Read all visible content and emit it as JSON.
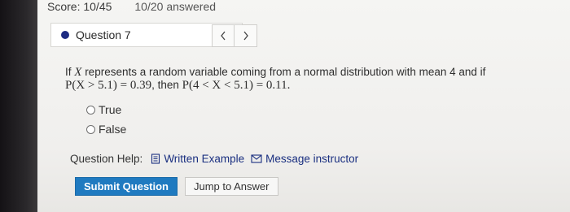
{
  "header": {
    "score": "Score: 10/45",
    "answered": "10/20 answered"
  },
  "question_nav": {
    "label": "Question 7",
    "prev_glyph": "<",
    "next_glyph": ">"
  },
  "question": {
    "line1_prefix": "If ",
    "line1_var": "X",
    "line1_rest": " represents a random variable coming from a normal distribution with mean 4 and if",
    "line2_expr1": "P(X > 5.1) = 0.39",
    "line2_then": ", then ",
    "line2_expr2": "P(4 < X < 5.1) = 0.11."
  },
  "options": [
    {
      "label": "True"
    },
    {
      "label": "False"
    }
  ],
  "help": {
    "label": "Question Help:",
    "written_example": "Written Example",
    "message_instructor": "Message instructor"
  },
  "actions": {
    "submit": "Submit Question",
    "jump": "Jump to Answer"
  },
  "colors": {
    "accent_dot": "#1d2b82",
    "submit_bg": "#1f7ac0",
    "link": "#1a2f80"
  }
}
